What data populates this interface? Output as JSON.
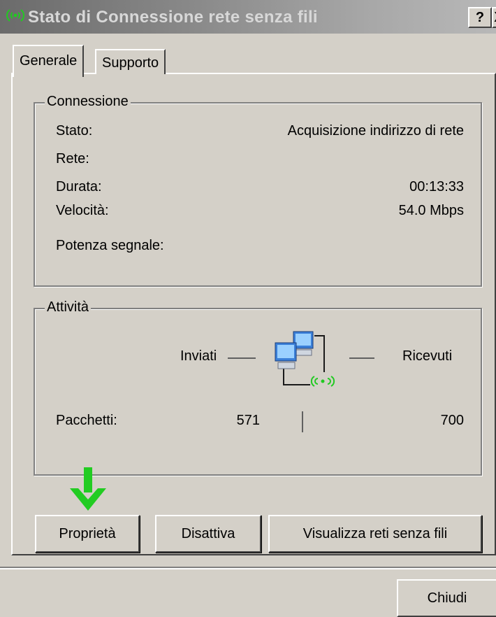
{
  "window": {
    "title": "Stato di Connessione rete senza fili",
    "help_button": "?",
    "close_button": "X"
  },
  "tabs": [
    {
      "label": "Generale",
      "active": true
    },
    {
      "label": "Supporto",
      "active": false
    }
  ],
  "connection": {
    "legend": "Connessione",
    "status_label": "Stato:",
    "status_value": "Acquisizione indirizzo di rete",
    "network_label": "Rete:",
    "network_value": "",
    "duration_label": "Durata:",
    "duration_value": "00:13:33",
    "speed_label": "Velocità:",
    "speed_value": "54.0 Mbps",
    "signal_label": "Potenza segnale:"
  },
  "activity": {
    "legend": "Attività",
    "sent_label": "Inviati",
    "received_label": "Ricevuti",
    "packets_label": "Pacchetti:",
    "packets_sent": "571",
    "packets_received": "700"
  },
  "buttons": {
    "properties": "Proprietà",
    "disable": "Disattiva",
    "view_networks": "Visualizza reti senza fili",
    "close": "Chiudi"
  },
  "icons": {
    "title": "wireless-network-icon",
    "activity": "network-computers-icon",
    "pointer": "green-down-arrow-icon"
  },
  "colors": {
    "face": "#d4d0c8",
    "titlebar": "#8a8a8a",
    "arrow": "#22cc22"
  }
}
